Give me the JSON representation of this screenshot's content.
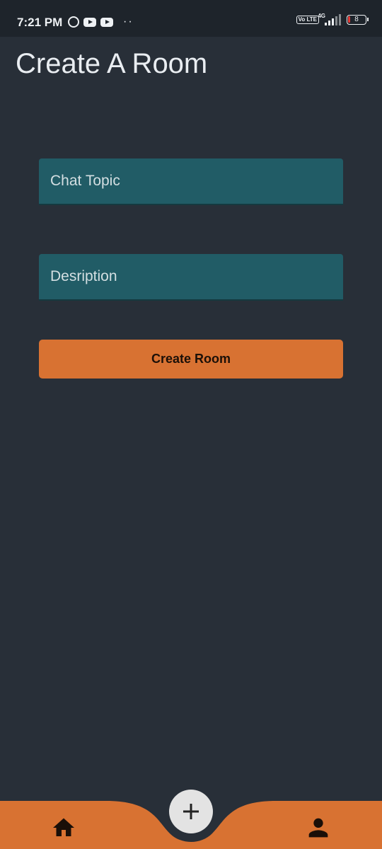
{
  "status_bar": {
    "time": "7:21 PM",
    "battery_level": "8",
    "network": "4G",
    "volte": "Vo LTE"
  },
  "page": {
    "title": "Create A Room"
  },
  "form": {
    "topic_placeholder": "Chat Topic",
    "description_placeholder": "Desription",
    "submit_label": "Create Room"
  },
  "bottom_nav": {
    "items": [
      {
        "icon": "home-icon"
      },
      {
        "icon": "plus-icon"
      },
      {
        "icon": "person-icon"
      }
    ]
  },
  "colors": {
    "background": "#282f38",
    "field": "#215c66",
    "accent": "#d87232",
    "fab": "#e3e3e3"
  }
}
